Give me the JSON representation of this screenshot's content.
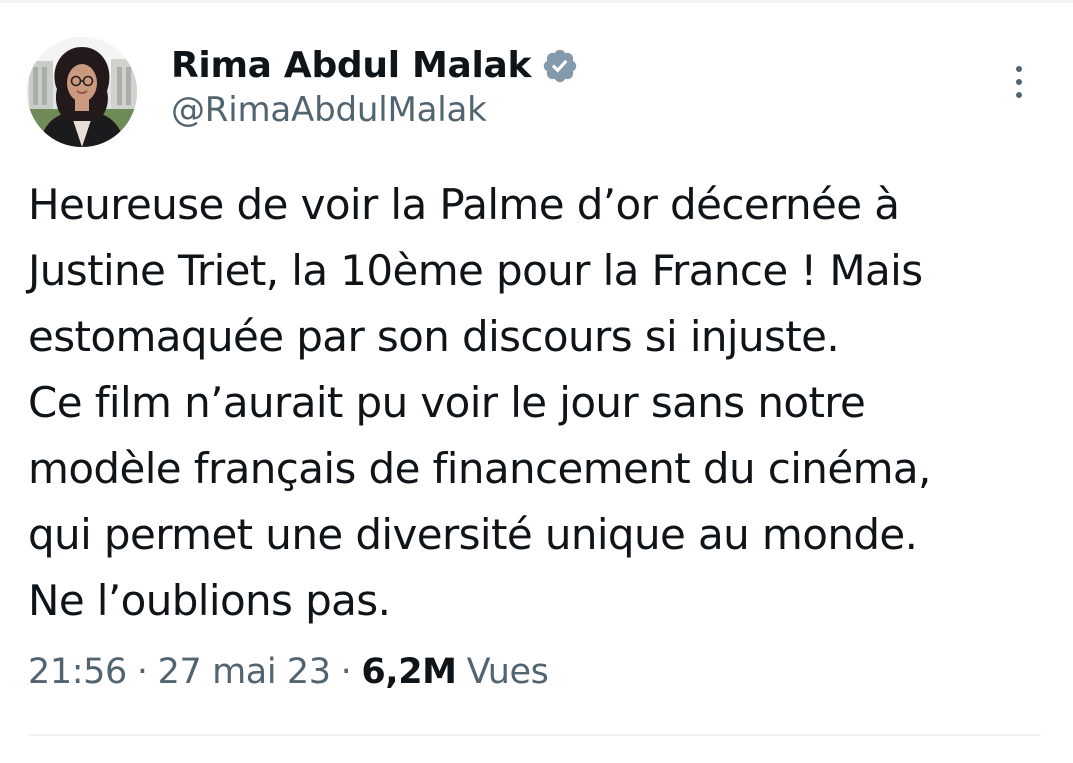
{
  "tweet": {
    "author": {
      "display_name": "Rima Abdul Malak",
      "handle": "@RimaAbdulMalak",
      "verified_icon": "verified-badge-icon",
      "avatar": "profile-photo"
    },
    "more_icon": "more-options-icon",
    "text_lines": [
      "Heureuse de voir la Palme d’or décernée à",
      "Justine Triet, la 10ème pour la France ! Mais",
      "estomaquée par son discours si injuste.",
      "Ce film n’aurait pu voir le jour sans notre",
      "modèle français de financement du cinéma,",
      "qui permet une diversité unique au monde.",
      "Ne l’oublions pas."
    ],
    "time": "21:56",
    "date": "27 mai 23",
    "separator": "·",
    "views_count": "6,2M",
    "views_label": "Vues"
  },
  "colors": {
    "text_primary": "#0f1419",
    "text_secondary": "#536471",
    "verified_badge": "#829aab",
    "divider": "#eff3f4"
  }
}
